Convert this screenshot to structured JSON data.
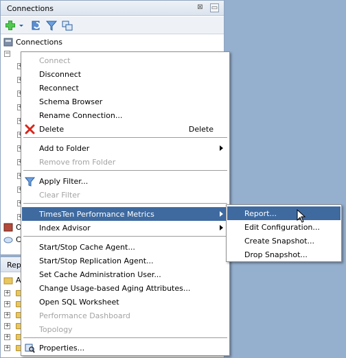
{
  "connections_panel": {
    "title": "Connections",
    "close_glyph": "⊠",
    "minimize_glyph": "▭",
    "toolbar_icons": [
      "add-connection-icon",
      "dropdown-arrow-icon",
      "refresh-icon",
      "filter-icon",
      "schema-browser-icon"
    ],
    "root_label": "Connections",
    "side_items": [
      "O",
      "Cl"
    ]
  },
  "reports_panel": {
    "title": "Rep",
    "root_label": "Al"
  },
  "context_menu": {
    "items": [
      {
        "label": "Connect",
        "disabled": true
      },
      {
        "label": "Disconnect",
        "disabled": false
      },
      {
        "label": "Reconnect",
        "disabled": false
      },
      {
        "label": "Schema Browser",
        "disabled": false
      },
      {
        "label": "Rename Connection...",
        "disabled": false
      },
      {
        "label": "Delete",
        "accelerator": "Delete",
        "icon": "delete-x-icon",
        "disabled": false
      },
      {
        "label": "Add to Folder",
        "submenu": true,
        "disabled": false
      },
      {
        "label": "Remove from Folder",
        "disabled": true
      },
      {
        "label": "Apply Filter...",
        "icon": "filter-icon",
        "disabled": false
      },
      {
        "label": "Clear Filter",
        "disabled": true
      },
      {
        "label": "TimesTen Performance Metrics",
        "submenu": true,
        "highlighted": true,
        "disabled": false
      },
      {
        "label": "Index Advisor",
        "submenu": true,
        "disabled": false
      },
      {
        "label": "Start/Stop Cache Agent...",
        "disabled": false
      },
      {
        "label": "Start/Stop Replication Agent...",
        "disabled": false
      },
      {
        "label": "Set Cache Administration User...",
        "disabled": false
      },
      {
        "label": "Change Usage-based Aging Attributes...",
        "disabled": false
      },
      {
        "label": "Open SQL Worksheet",
        "disabled": false
      },
      {
        "label": "Performance Dashboard",
        "disabled": true
      },
      {
        "label": "Topology",
        "disabled": true
      },
      {
        "label": "Properties...",
        "icon": "properties-icon",
        "disabled": false
      }
    ]
  },
  "submenu": {
    "items": [
      {
        "label": "Report...",
        "highlighted": true
      },
      {
        "label": "Edit Configuration..."
      },
      {
        "label": "Create Snapshot..."
      },
      {
        "label": "Drop Snapshot..."
      }
    ]
  },
  "colors": {
    "highlight": "#3e6aa0",
    "disabled_text": "#a3a3a3",
    "desktop_bg": "#95afce"
  }
}
